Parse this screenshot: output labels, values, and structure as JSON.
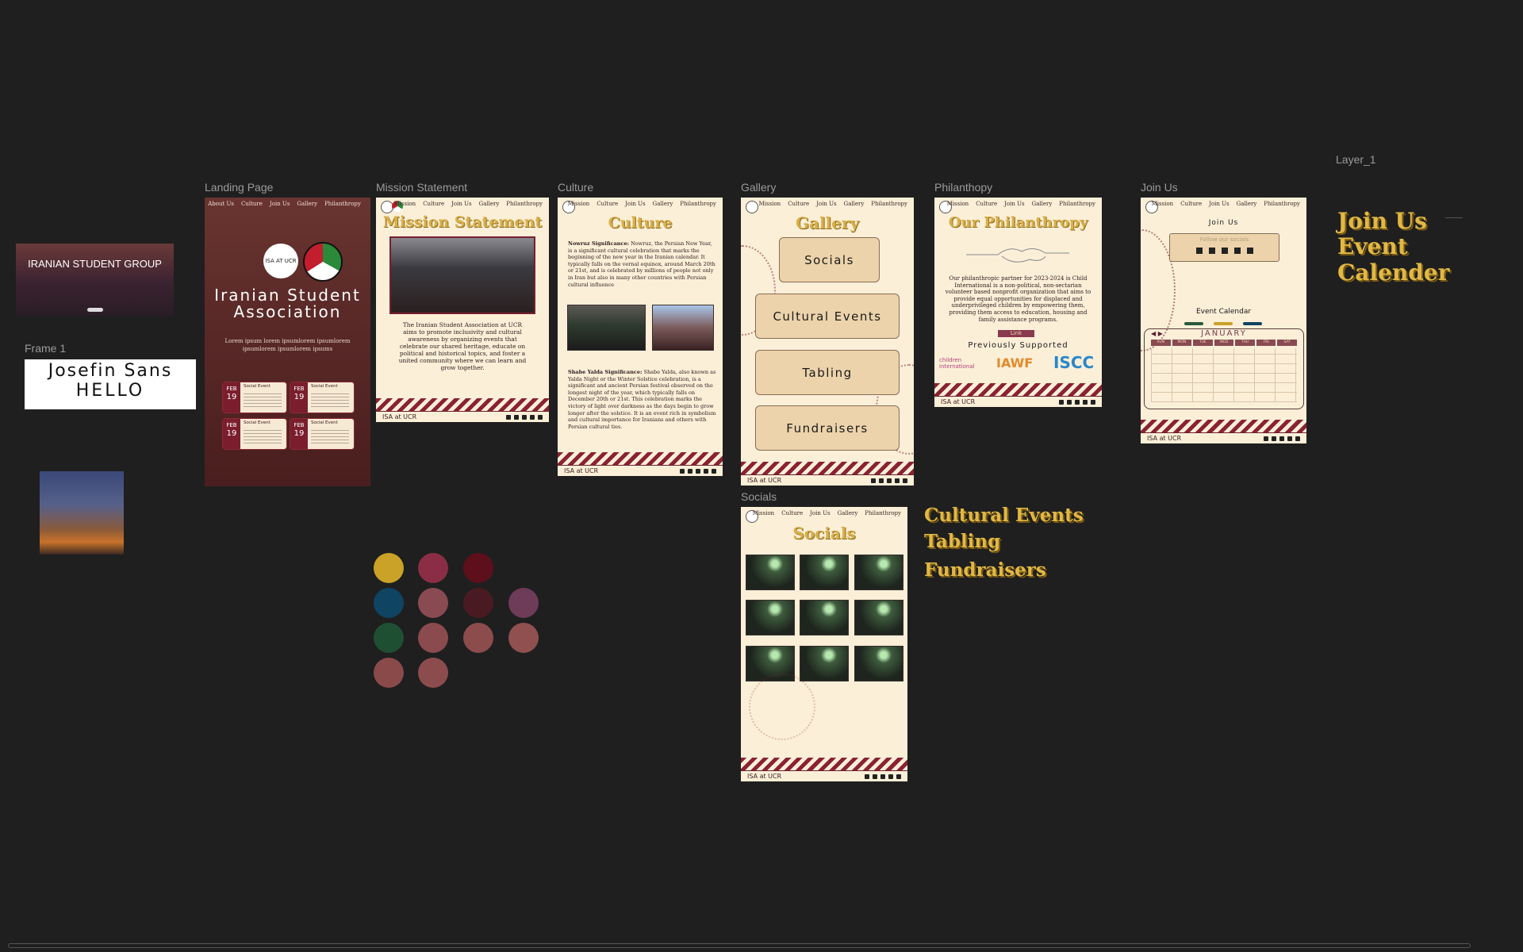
{
  "canvas": {
    "bg": "#1f1f1f",
    "label_layer": "Layer_1"
  },
  "frames": {
    "landing": "Landing Page",
    "mission": "Mission Statement",
    "culture": "Culture",
    "gallery": "Gallery",
    "philanthropy": "Philanthopy",
    "joinus": "Join Us",
    "socials": "Socials",
    "frame1": "Frame 1"
  },
  "nav": [
    "Mission",
    "Culture",
    "Join Us",
    "Gallery",
    "Philanthropy"
  ],
  "landing_nav": [
    "About Us",
    "Culture",
    "Join Us",
    "Gallery",
    "Philanthropy"
  ],
  "thumb": {
    "title": "IRANIAN STUDENT GROUP"
  },
  "frame1": {
    "line1": "Josefin Sans",
    "line2": "HELLO"
  },
  "landing": {
    "title": "Iranian Student Association",
    "lorem": "Lorem ipsum lorem ipsumlorem ipsumlorem ipsumlorem ipsumlorem ipsums",
    "logo_text": "ISA AT UCR",
    "events": [
      {
        "month": "FEB",
        "day": "19",
        "label": "Social Event"
      },
      {
        "month": "FEB",
        "day": "19",
        "label": "Social Event"
      },
      {
        "month": "FEB",
        "day": "19",
        "label": "Social Event"
      },
      {
        "month": "FEB",
        "day": "19",
        "label": "Social Event"
      }
    ]
  },
  "mission": {
    "title": "Mission Statement",
    "body": "The Iranian Student Association at UCR aims to promote inclusivity and cultural awareness by organizing events that celebrate our shared heritage, educate on political and historical topics, and foster a united community where we can learn and grow together.",
    "footer": "ISA at UCR"
  },
  "culture": {
    "title": "Culture",
    "p1_head": "Nowruz Significance:",
    "p1": "Nowruz, the Persian New Year, is a significant cultural celebration that marks the beginning of the new year in the Iranian calendar. It typically falls on the vernal equinox, around March 20th or 21st, and is celebrated by millions of people not only in Iran but also in many other countries with Persian cultural influence",
    "p2_head": "Shabe Yalda Significance:",
    "p2": "Shabe Yalda, also known as Yalda Night or the Winter Solstice celebration, is a significant and ancient Persian festival observed on the longest night of the year, which typically falls on December 20th or 21st. This celebration marks the victory of light over darkness as the days begin to grow longer after the solstice. It is an event rich in symbolism and cultural importance for Iranians and others with Persian cultural ties.",
    "footer": "ISA at UCR"
  },
  "gallery": {
    "title": "Gallery",
    "buttons": [
      "Socials",
      "Cultural Events",
      "Tabling",
      "Fundraisers"
    ],
    "footer": "ISA at UCR"
  },
  "philanthropy": {
    "title": "Our Philanthropy",
    "body": "Our philanthropic partner for 2023-2024 is Child International is a non-political, non-sectarian volunteer based nonprofit organization that aims to provide equal opportunities for displaced and underprivileged children by empowering them, providing them access to education, housing and family assistance programs.",
    "link": "Link",
    "prev": "Previously Supported",
    "orgs": [
      "children international",
      "IAWF",
      "ISCC"
    ],
    "footer": "ISA at UCR"
  },
  "joinus": {
    "title": "Join Us",
    "follow": "Follow our socials",
    "cal_title": "Event Calendar",
    "month": "JANUARY",
    "days": [
      "SUN",
      "MON",
      "TUE",
      "WED",
      "THU",
      "FRI",
      "SAT"
    ],
    "footer": "ISA at UCR"
  },
  "socials": {
    "title": "Socials",
    "footer": "ISA at UCR"
  },
  "side_text": {
    "join": "Join Us",
    "calendar": "Event Calender",
    "cultural": "Cultural Events",
    "tabling": "Tabling",
    "fundraisers": "Fundraisers"
  },
  "swatches": [
    "#c9a227",
    "#8b2e45",
    "#5e0f1c",
    "#0f4462",
    "#8a4a52",
    "#4a1a22",
    "#6e3b58",
    "#1f4f33",
    "#8a4a4e",
    "#8c4c4c",
    "#905050",
    "#8a4a4a",
    "#8c4c4e"
  ]
}
